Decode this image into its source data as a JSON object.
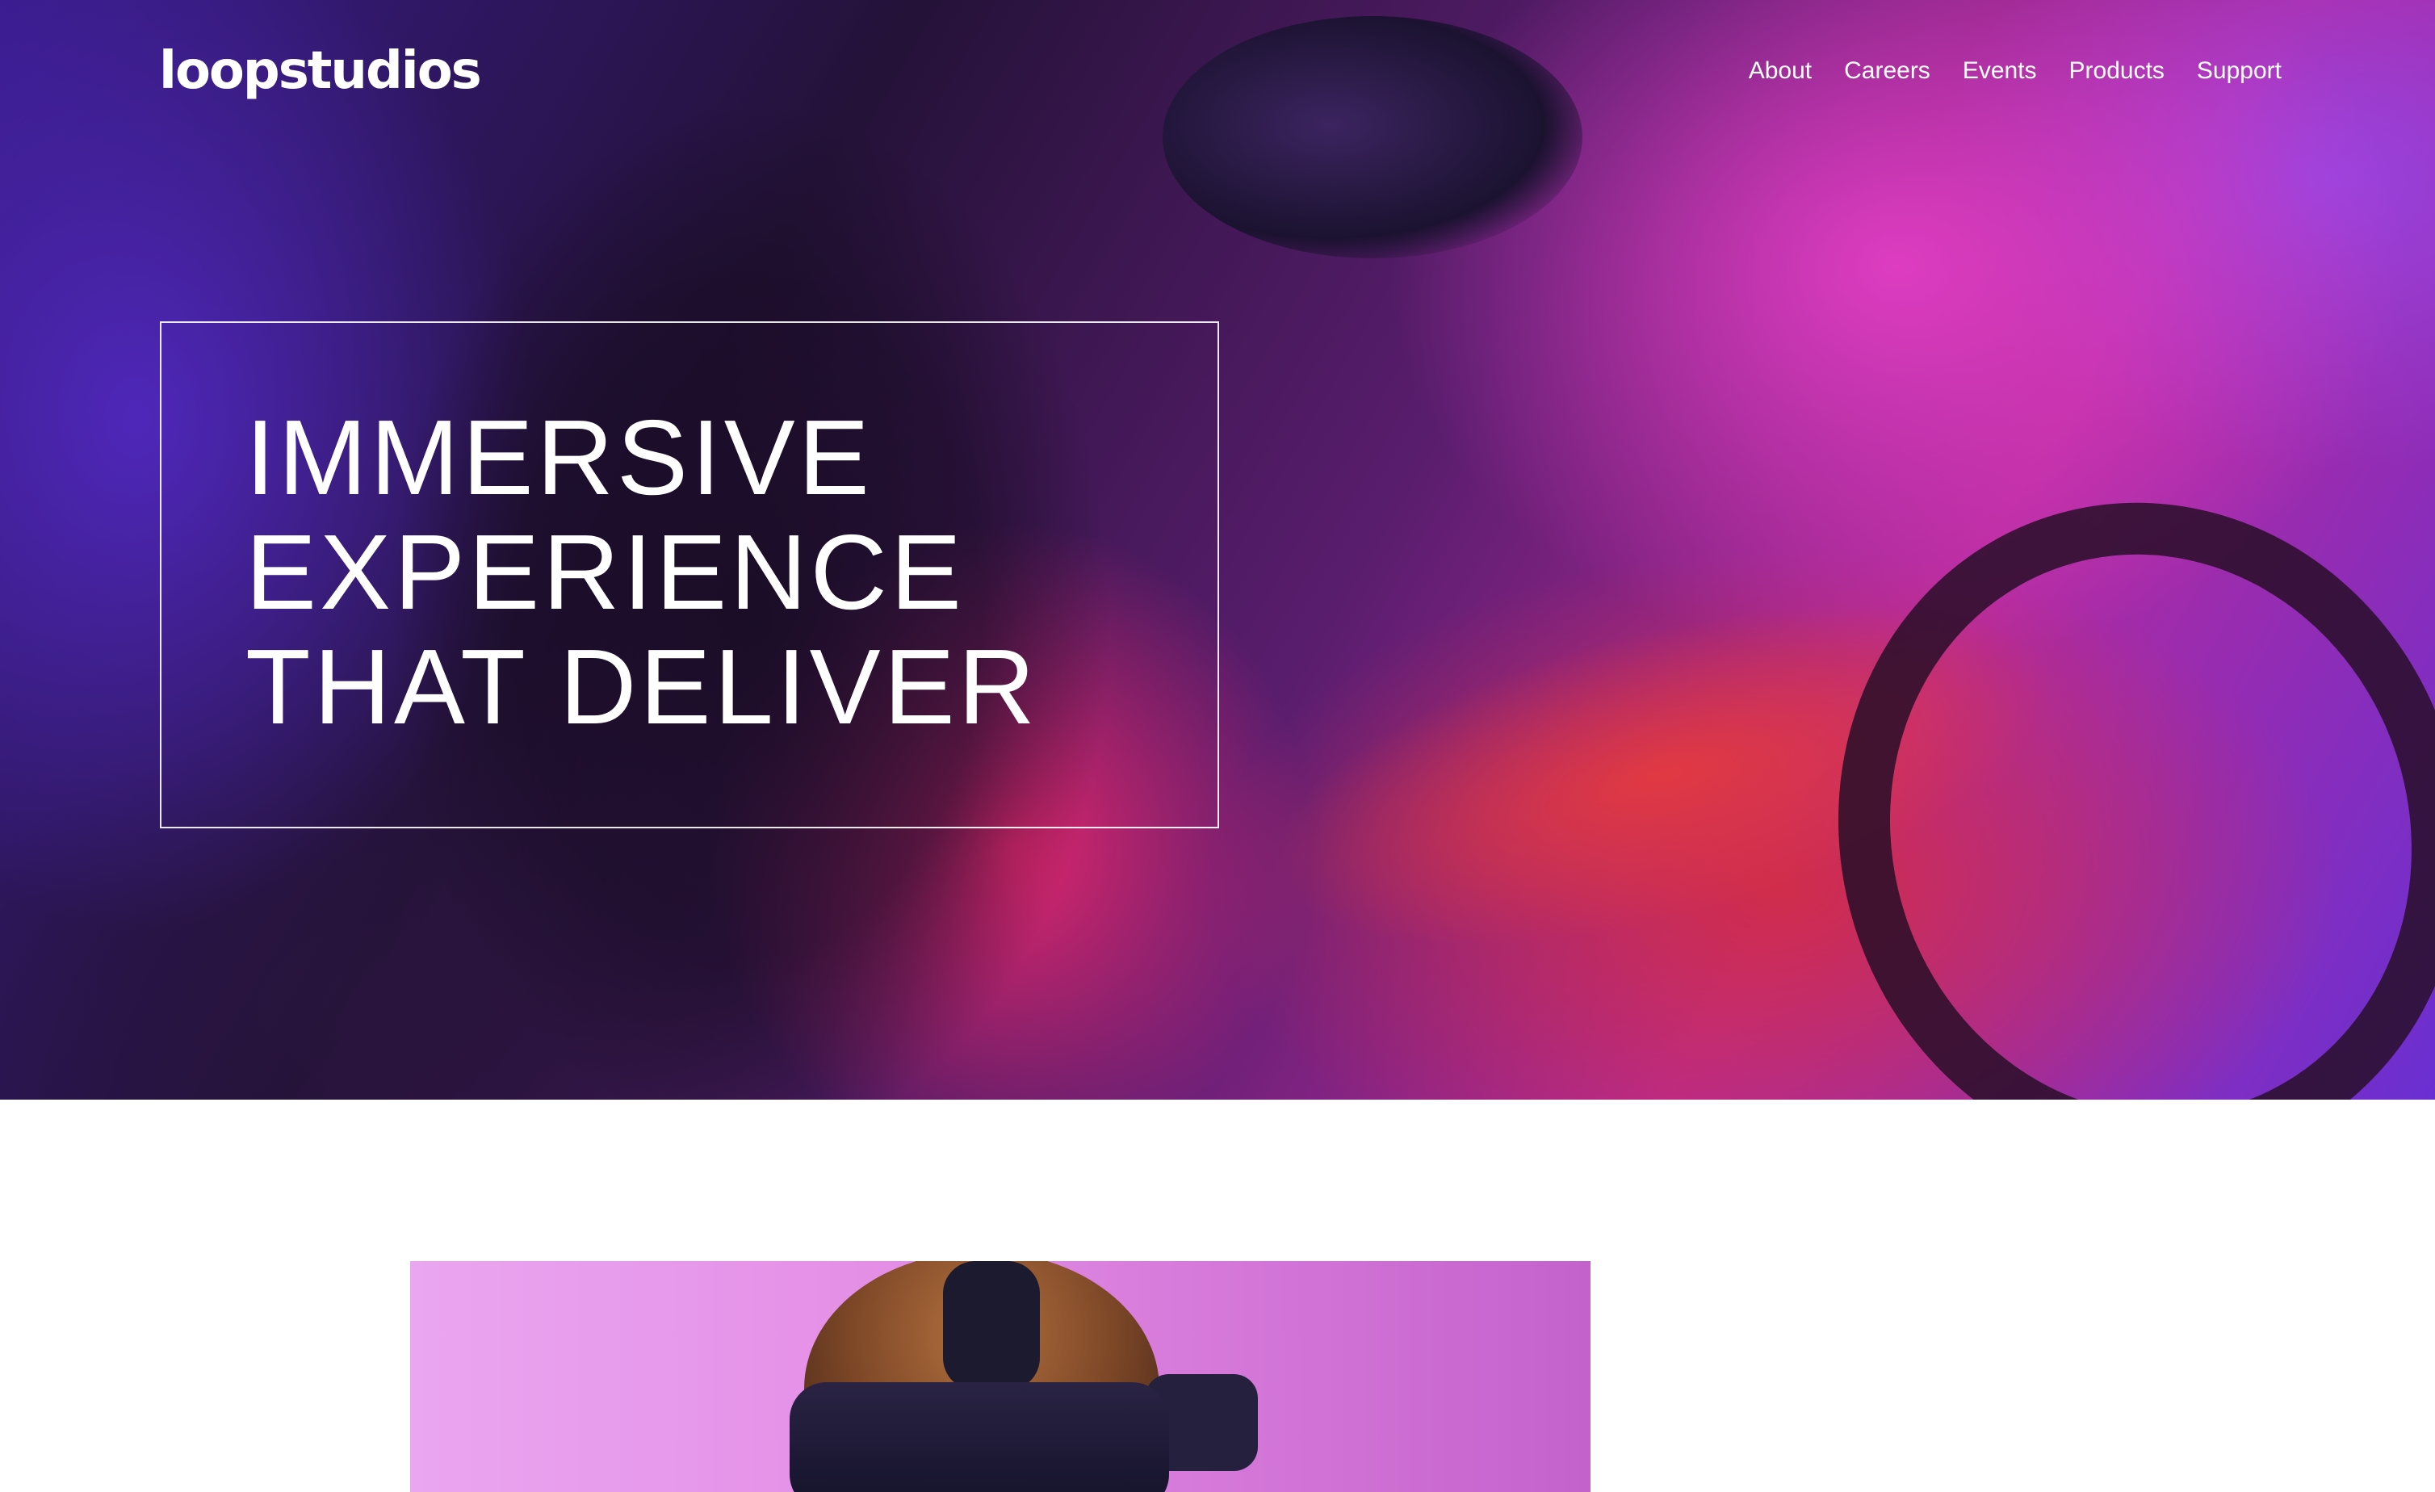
{
  "brand": {
    "logo": "loopstudios"
  },
  "nav": {
    "items": [
      {
        "label": "About"
      },
      {
        "label": "Careers"
      },
      {
        "label": "Events"
      },
      {
        "label": "Products"
      },
      {
        "label": "Support"
      }
    ]
  },
  "hero": {
    "headline_lines": [
      "IMMERSIVE",
      "EXPERIENCE",
      "THAT DELIVER"
    ]
  },
  "colors": {
    "text_on_hero": "#ffffff",
    "page_background": "#ffffff",
    "hero_accent_magenta": "#d23fc4",
    "hero_accent_blue": "#5a2fd0",
    "hero_accent_red": "#e0344c"
  }
}
